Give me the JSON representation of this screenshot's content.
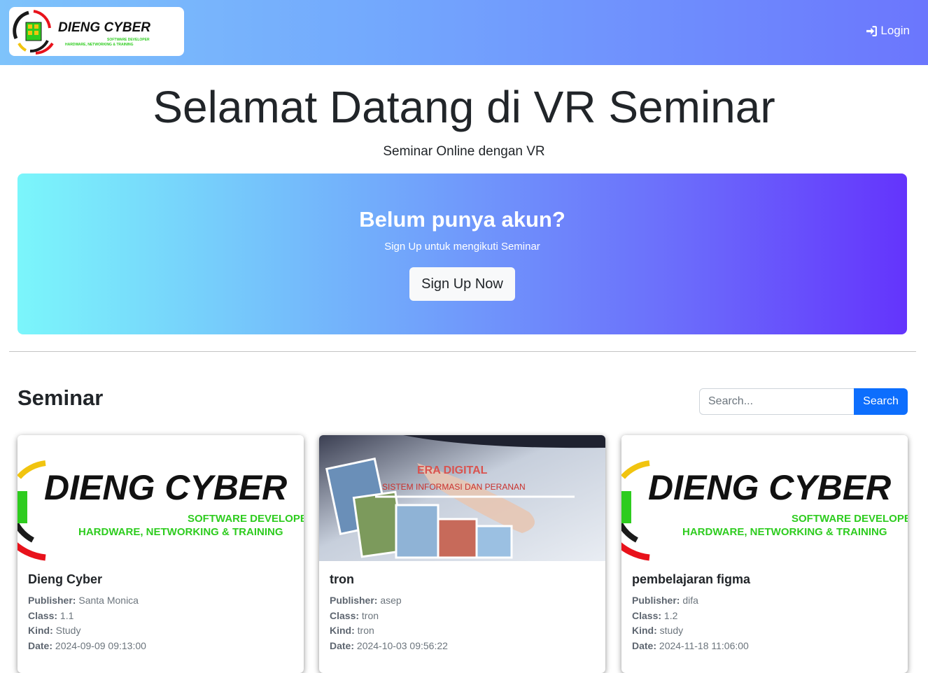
{
  "navbar": {
    "logo": {
      "brand": "DIENG CYBER",
      "tagline_1": "SOFTWARE DEVELOPER",
      "tagline_2": "HARDWARE, NETWORKING & TRAINING"
    },
    "login_label": "Login",
    "login_icon": "sign-in-icon"
  },
  "hero": {
    "title": "Selamat Datang di VR Seminar",
    "subtitle": "Seminar Online dengan VR"
  },
  "signup": {
    "title": "Belum punya akun?",
    "text": "Sign Up untuk mengikuti Seminar",
    "button_label": "Sign Up Now"
  },
  "seminar": {
    "heading": "Seminar",
    "search_placeholder": "Search...",
    "search_button": "Search",
    "cards": [
      {
        "title": "Dieng Cyber",
        "publisher_label": "Publisher:",
        "publisher": "Santa Monica",
        "class_label": "Class:",
        "class": "1.1",
        "kind_label": "Kind:",
        "kind": "Study",
        "date_label": "Date:",
        "date": "2024-09-09 09:13:00",
        "image": {
          "brand": "DIENG CYBER",
          "line_1": "SOFTWARE DEVELOPER",
          "line_2": "HARDWARE, NETWORKING & TRAINING"
        }
      },
      {
        "title": "tron",
        "publisher_label": "Publisher:",
        "publisher": "asep",
        "class_label": "Class:",
        "class": "tron",
        "kind_label": "Kind:",
        "kind": "tron",
        "date_label": "Date:",
        "date": "2024-10-03 09:56:22",
        "image": {
          "headline": "ERA DIGITAL",
          "subline": "SISTEM INFORMASI DAN PERANAN"
        }
      },
      {
        "title": "pembelajaran figma",
        "publisher_label": "Publisher:",
        "publisher": "difa",
        "class_label": "Class:",
        "class": "1.2",
        "kind_label": "Kind:",
        "kind": "study",
        "date_label": "Date:",
        "date": "2024-11-18 11:06:00",
        "image": {
          "brand": "DIENG CYBER",
          "line_1": "SOFTWARE DEVELOPER",
          "line_2": "HARDWARE, NETWORKING & TRAINING"
        }
      }
    ]
  },
  "colors": {
    "primary": "#0d6efd",
    "nav_gradient_start": "#7ec3fb",
    "nav_gradient_end": "#6b76fd",
    "panel_gradient_start": "#7bf6fb",
    "panel_gradient_end": "#6434fc",
    "logo_green": "#2ecc1f",
    "logo_red": "#e8121b"
  }
}
